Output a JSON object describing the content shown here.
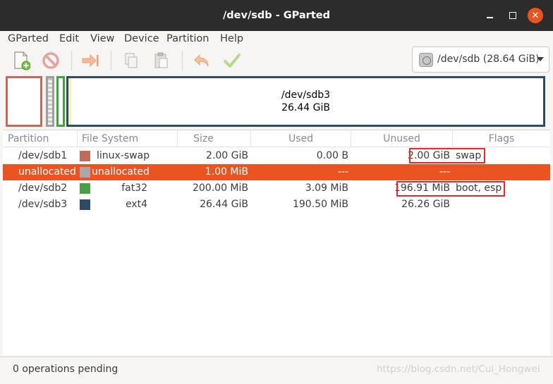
{
  "window": {
    "title": "/dev/sdb - GParted"
  },
  "menu": [
    "GParted",
    "Edit",
    "View",
    "Device",
    "Partition",
    "Help"
  ],
  "toolbar": {
    "device_label": "/dev/sdb (28.64 GiB)"
  },
  "map": {
    "ext4_name": "/dev/sdb3",
    "ext4_size": "26.44 GiB"
  },
  "table": {
    "headers": [
      "Partition",
      "File System",
      "Size",
      "Used",
      "Unused",
      "Flags"
    ],
    "rows": [
      {
        "partition": "/dev/sdb1",
        "fs": "linux-swap",
        "size": "2.00 GiB",
        "used": "0.00 B",
        "unused": "2.00 GiB",
        "flags": "swap"
      },
      {
        "partition": "unallocated",
        "fs": "unallocated",
        "size": "1.00 MiB",
        "used": "---",
        "unused": "---",
        "flags": ""
      },
      {
        "partition": "/dev/sdb2",
        "fs": "fat32",
        "size": "200.00 MiB",
        "used": "3.09 MiB",
        "unused": "196.91 MiB",
        "flags": "boot, esp"
      },
      {
        "partition": "/dev/sdb3",
        "fs": "ext4",
        "size": "26.44 GiB",
        "used": "190.50 MiB",
        "unused": "26.26 GiB",
        "flags": ""
      }
    ]
  },
  "colors": {
    "accent": "#e95420",
    "linux_swap": "#c46a5a",
    "unallocated": "#a8a8a8",
    "fat32": "#46a046",
    "ext4": "#2f4a66",
    "highlight_box": "#e02b2b"
  },
  "status": {
    "text": "0 operations pending"
  },
  "watermark": "https://blog.csdn.net/Cui_Hongwei"
}
